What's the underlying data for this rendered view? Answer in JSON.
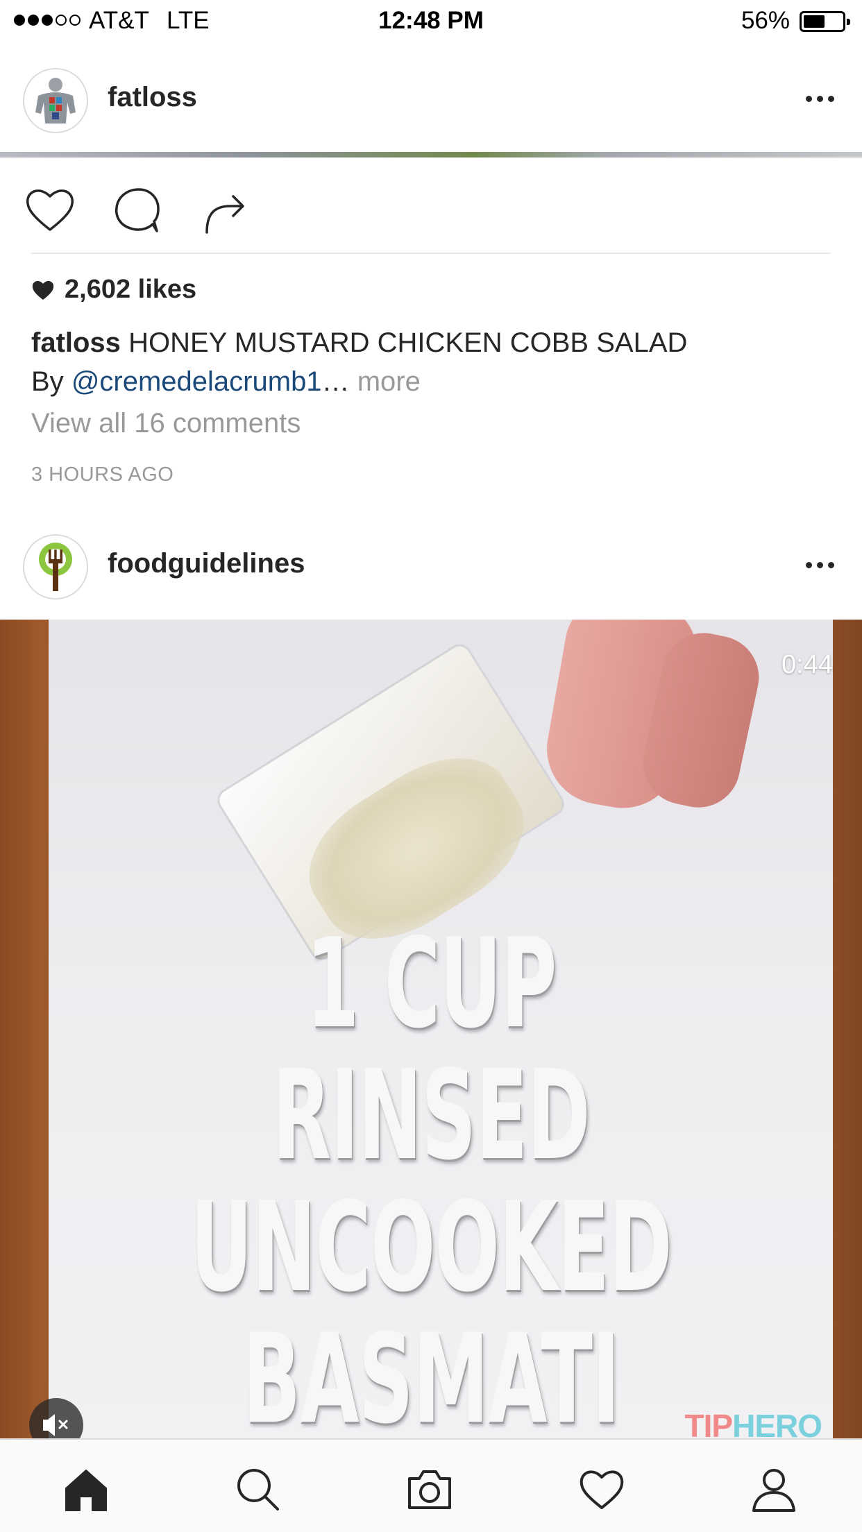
{
  "status_bar": {
    "signal_bars_filled": 3,
    "signal_bars_total": 5,
    "carrier": "AT&T",
    "network": "LTE",
    "time": "12:48 PM",
    "battery_percent_text": "56%",
    "battery_level": 0.56
  },
  "post1": {
    "username": "fatloss",
    "avatar_icon": "muscle-anatomy-avatar",
    "likes": "2,602 likes",
    "caption_user": "fatloss",
    "caption_title": "HONEY MUSTARD CHICKEN COBB SALAD",
    "caption_by": "By",
    "caption_mention": "@cremedelacrumb1",
    "caption_ellipsis": "…",
    "caption_more": "more",
    "view_comments": "View all 16 comments",
    "timestamp": "3 HOURS AGO"
  },
  "post2": {
    "username": "foodguidelines",
    "avatar_icon": "tree-fork-avatar",
    "video_duration": "0:44",
    "overlay_lines": [
      "1 CUP RINSED",
      "UNCOOKED",
      "BASMATI RICE"
    ],
    "watermark_part1": "TIP",
    "watermark_part2": "HERO"
  },
  "actions": [
    "heart-icon",
    "comment-icon",
    "share-icon"
  ],
  "tab_bar": [
    "home-icon",
    "search-icon",
    "camera-icon",
    "activity-heart-icon",
    "profile-icon"
  ],
  "colors": {
    "text": "#262626",
    "secondary": "#999999",
    "mention": "#1b4a7a",
    "divider": "#e6e6e6"
  }
}
